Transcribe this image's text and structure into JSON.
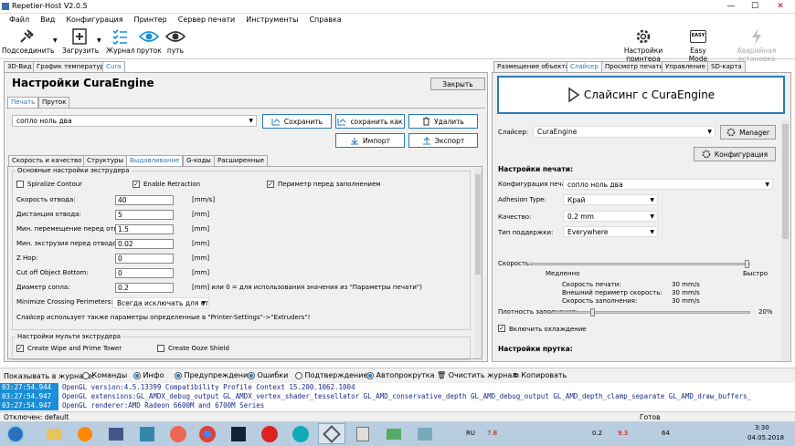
{
  "app": {
    "title": "Repetier-Host V2.0.5"
  },
  "menu": [
    "Файл",
    "Вид",
    "Конфигурация",
    "Принтер",
    "Сервер печати",
    "Инструменты",
    "Справка"
  ],
  "toolbar": {
    "connect": "Подсоединить",
    "load": "Загрузить",
    "log": "Журнал",
    "filament": "пруток",
    "path": "путь",
    "printer_settings": "Настройки принтера",
    "easy_mode": "Easy Mode",
    "emergency": "Аварийная остановка",
    "easy_icon_text": "EASY"
  },
  "left_tabs": [
    "3D-Вид",
    "График температур",
    "Cura"
  ],
  "cura": {
    "title": "Настройки CuraEngine",
    "close": "Закрыть",
    "subtabs": [
      "Печать",
      "Пруток"
    ],
    "profile": "сопло ноль два",
    "save": "Сохранить",
    "save_as": "сохранить как",
    "delete": "Удалить",
    "import": "Импорт",
    "export": "Экспорт",
    "section_tabs": [
      "Скорость и качество",
      "Структуры",
      "Выдавливание",
      "G-коды",
      "Расширенные"
    ],
    "extruder_group": "Основные настройки экструдера",
    "spiralize": "Spiralize Contour",
    "enable_retraction": "Enable Retraction",
    "perimeter_before_infill": "Периметр перед заполнением",
    "fields": [
      {
        "label": "Скорость отвода:",
        "value": "40",
        "unit": "[mm/s]"
      },
      {
        "label": "Дистанция отвода:",
        "value": "5",
        "unit": "[mm]"
      },
      {
        "label": "Мин. перемещение перед отводом:",
        "value": "1.5",
        "unit": "[mm]"
      },
      {
        "label": "Мин. экструзия перед отводом:",
        "value": "0.02",
        "unit": "[mm]"
      },
      {
        "label": "Z Hop:",
        "value": "0",
        "unit": "[mm]"
      },
      {
        "label": "Cut off Object Bottom:",
        "value": "0",
        "unit": "[mm]"
      },
      {
        "label": "Диаметр сопла:",
        "value": "0.2",
        "unit": "[mm] или 0 = для использования значения из \"Параметры печати\")"
      }
    ],
    "min_crossing_label": "Minimize Crossing Perimeters:",
    "min_crossing_value": "Всегда исключать для стен",
    "slicer_note": "Слайсер использует также параметры определенные в \"Printer-Settings\"->\"Extruders\"!",
    "multi_group": "Настройки мульти экструдера",
    "wipe_tower": "Create Wipe and Prime Tower",
    "ooze_shield": "Create Ooze Shield"
  },
  "right_tabs": [
    "Размещение объекта",
    "Слайсер",
    "Просмотр печати",
    "Управление",
    "SD-карта"
  ],
  "slicer": {
    "slice_button": "Слайсинг с CuraEngine",
    "slicer_label": "Слайсер:",
    "slicer_value": "CuraEngine",
    "manager": "Manager",
    "configure": "Конфигурация",
    "print_settings": "Настройки печати:",
    "print_config_label": "Конфигурация печати:",
    "print_config_value": "сопло ноль два",
    "adhesion_label": "Adhesion Type:",
    "adhesion_value": "Край",
    "quality_label": "Качество:",
    "quality_value": "0.2 mm",
    "support_label": "Тип поддержки:",
    "support_value": "Everywhere",
    "speed_label": "Скорость:",
    "slow": "Медленно",
    "fast": "Быстро",
    "print_speed_label": "Скорость печати:",
    "print_speed": "30 mm/s",
    "outer_perimeter_label": "Внешний периметр скорость:",
    "outer_perimeter": "30 mm/s",
    "infill_speed_label": "Скорость заполнения:",
    "infill_speed": "30 mm/s",
    "infill_density_label": "Плотность заполнения:",
    "infill_density": "20%",
    "speed_level": 1.0,
    "infill_level": 0.2,
    "cooling": "Включить охлаждение",
    "filament_settings": "Настройки прутка:"
  },
  "logbar": {
    "show": "Показывать в журнале:",
    "commands": "Команды",
    "info": "Инфо",
    "warnings": "Предупреждения",
    "errors": "Ошибки",
    "ack": "Подтверждение",
    "autoscroll": "Автопрокрутка",
    "clear": "Очистить журнал",
    "copy": "Копировать"
  },
  "log": [
    {
      "ts": "03:27:54.944",
      "msg": "OpenGL version:4.5.13399 Compatibility Profile Context 15.200.1062.1004"
    },
    {
      "ts": "03:27:54.947",
      "msg": "OpenGL extensions:GL_AMDX_debug_output GL_AMDX_vertex_shader_tessellator GL_AMD_conservative_depth GL_AMD_debug_output GL_AMD_depth_clamp_separate GL_AMD_draw_buffers_"
    },
    {
      "ts": "03:27:54.947",
      "msg": "OpenGL renderer:AMD Radeon 6600M and 6700M Series"
    }
  ],
  "status": {
    "left": "Отключен: default",
    "right": "Готов"
  },
  "tray": {
    "lang": "RU",
    "time": "3:30",
    "date": "04.05.2018",
    "n1": "7.8",
    "n2": "0.2",
    "n3": "9.3",
    "n4": "64"
  }
}
